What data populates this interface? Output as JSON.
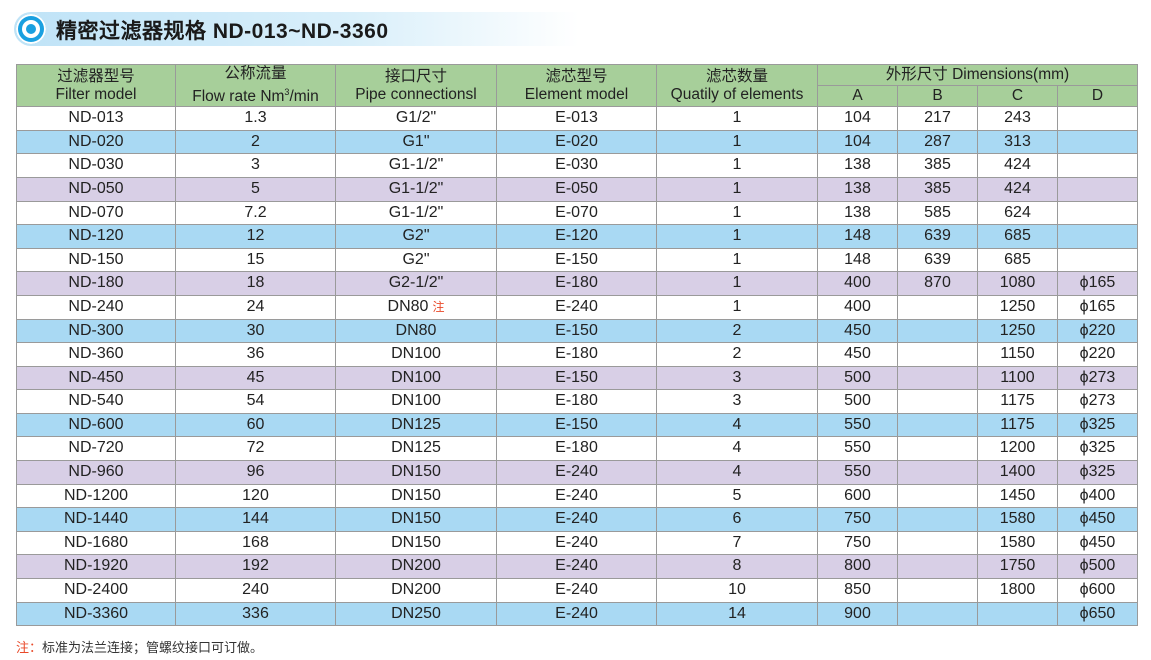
{
  "title": "精密过滤器规格 ND-013~ND-3360",
  "header": {
    "model_cn": "过滤器型号",
    "model_en": "Filter model",
    "flow_cn": "公称流量",
    "flow_en": "Flow rate  Nm",
    "flow_sup": "3",
    "flow_unit": "/min",
    "pipe_cn": "接口尺寸",
    "pipe_en": "Pipe connectionsl",
    "element_cn": "滤芯型号",
    "element_en": "Element model",
    "qty_cn": "滤芯数量",
    "qty_en": "Quatily of elements",
    "dim_label": "外形尺寸   Dimensions(mm)",
    "dim_a": "A",
    "dim_b": "B",
    "dim_c": "C",
    "dim_d": "D"
  },
  "rows": [
    {
      "model": "ND-013",
      "flow": "1.3",
      "pipe": "G1/2\"",
      "element": "E-013",
      "qty": "1",
      "a": "104",
      "b": "217",
      "c": "243",
      "d": "",
      "color": "white"
    },
    {
      "model": "ND-020",
      "flow": "2",
      "pipe": "G1\"",
      "element": "E-020",
      "qty": "1",
      "a": "104",
      "b": "287",
      "c": "313",
      "d": "",
      "color": "blue"
    },
    {
      "model": "ND-030",
      "flow": "3",
      "pipe": "G1-1/2\"",
      "element": "E-030",
      "qty": "1",
      "a": "138",
      "b": "385",
      "c": "424",
      "d": "",
      "color": "white"
    },
    {
      "model": "ND-050",
      "flow": "5",
      "pipe": "G1-1/2\"",
      "element": "E-050",
      "qty": "1",
      "a": "138",
      "b": "385",
      "c": "424",
      "d": "",
      "color": "purple"
    },
    {
      "model": "ND-070",
      "flow": "7.2",
      "pipe": "G1-1/2\"",
      "element": "E-070",
      "qty": "1",
      "a": "138",
      "b": "585",
      "c": "624",
      "d": "",
      "color": "white"
    },
    {
      "model": "ND-120",
      "flow": "12",
      "pipe": "G2\"",
      "element": "E-120",
      "qty": "1",
      "a": "148",
      "b": "639",
      "c": "685",
      "d": "",
      "color": "blue"
    },
    {
      "model": "ND-150",
      "flow": "15",
      "pipe": "G2\"",
      "element": "E-150",
      "qty": "1",
      "a": "148",
      "b": "639",
      "c": "685",
      "d": "",
      "color": "white"
    },
    {
      "model": "ND-180",
      "flow": "18",
      "pipe": "G2-1/2\"",
      "element": "E-180",
      "qty": "1",
      "a": "400",
      "b": "870",
      "c": "1080",
      "d": "ϕ165",
      "color": "purple"
    },
    {
      "model": "ND-240",
      "flow": "24",
      "pipe": "DN80",
      "pipe_note": "注",
      "element": "E-240",
      "qty": "1",
      "a": "400",
      "b": "",
      "c": "1250",
      "d": "ϕ165",
      "color": "white"
    },
    {
      "model": "ND-300",
      "flow": "30",
      "pipe": "DN80",
      "element": "E-150",
      "qty": "2",
      "a": "450",
      "b": "",
      "c": "1250",
      "d": "ϕ220",
      "color": "blue"
    },
    {
      "model": "ND-360",
      "flow": "36",
      "pipe": "DN100",
      "element": "E-180",
      "qty": "2",
      "a": "450",
      "b": "",
      "c": "1150",
      "d": "ϕ220",
      "color": "white"
    },
    {
      "model": "ND-450",
      "flow": "45",
      "pipe": "DN100",
      "element": "E-150",
      "qty": "3",
      "a": "500",
      "b": "",
      "c": "1100",
      "d": "ϕ273",
      "color": "purple"
    },
    {
      "model": "ND-540",
      "flow": "54",
      "pipe": "DN100",
      "element": "E-180",
      "qty": "3",
      "a": "500",
      "b": "",
      "c": "1175",
      "d": "ϕ273",
      "color": "white"
    },
    {
      "model": "ND-600",
      "flow": "60",
      "pipe": "DN125",
      "element": "E-150",
      "qty": "4",
      "a": "550",
      "b": "",
      "c": "1175",
      "d": "ϕ325",
      "color": "blue"
    },
    {
      "model": "ND-720",
      "flow": "72",
      "pipe": "DN125",
      "element": "E-180",
      "qty": "4",
      "a": "550",
      "b": "",
      "c": "1200",
      "d": "ϕ325",
      "color": "white"
    },
    {
      "model": "ND-960",
      "flow": "96",
      "pipe": "DN150",
      "element": "E-240",
      "qty": "4",
      "a": "550",
      "b": "",
      "c": "1400",
      "d": "ϕ325",
      "color": "purple"
    },
    {
      "model": "ND-1200",
      "flow": "120",
      "pipe": "DN150",
      "element": "E-240",
      "qty": "5",
      "a": "600",
      "b": "",
      "c": "1450",
      "d": "ϕ400",
      "color": "white"
    },
    {
      "model": "ND-1440",
      "flow": "144",
      "pipe": "DN150",
      "element": "E-240",
      "qty": "6",
      "a": "750",
      "b": "",
      "c": "1580",
      "d": "ϕ450",
      "color": "blue"
    },
    {
      "model": "ND-1680",
      "flow": "168",
      "pipe": "DN150",
      "element": "E-240",
      "qty": "7",
      "a": "750",
      "b": "",
      "c": "1580",
      "d": "ϕ450",
      "color": "white"
    },
    {
      "model": "ND-1920",
      "flow": "192",
      "pipe": "DN200",
      "element": "E-240",
      "qty": "8",
      "a": "800",
      "b": "",
      "c": "1750",
      "d": "ϕ500",
      "color": "purple"
    },
    {
      "model": "ND-2400",
      "flow": "240",
      "pipe": "DN200",
      "element": "E-240",
      "qty": "10",
      "a": "850",
      "b": "",
      "c": "1800",
      "d": "ϕ600",
      "color": "white"
    },
    {
      "model": "ND-3360",
      "flow": "336",
      "pipe": "DN250",
      "element": "E-240",
      "qty": "14",
      "a": "900",
      "b": "",
      "c": "",
      "d": "ϕ650",
      "color": "blue"
    }
  ],
  "footnote": {
    "mark": "注：",
    "text": "标准为法兰连接；管螺纹接口可订做。"
  },
  "colors": {
    "header": "#a7cf9a",
    "blue_row": "#a9d9f3",
    "purple_row": "#d8cfe6",
    "accent": "#1aa0e0",
    "note": "#e94a2a"
  }
}
